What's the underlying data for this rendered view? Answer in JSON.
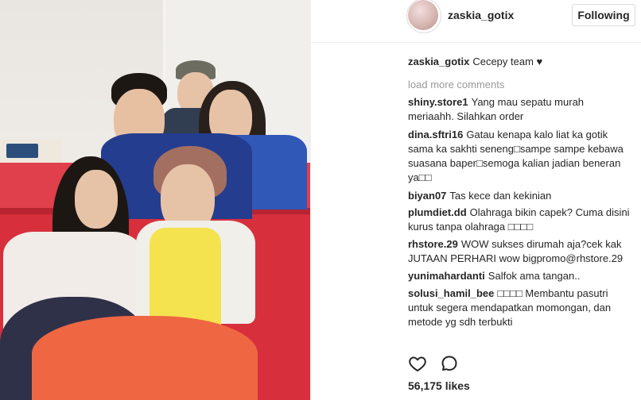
{
  "post": {
    "username": "zaskia_gotix",
    "follow_label": "Following",
    "caption_user": "zaskia_gotix",
    "caption_text": "Cecepy team ♥",
    "load_more": "load more comments",
    "likes": "56,175 likes"
  },
  "comments": [
    {
      "user": "shiny.store1",
      "text": "Yang mau sepatu murah meriaahh. Silahkan order"
    },
    {
      "user": "dina.sftri16",
      "text": "Gatau kenapa kalo liat ka gotik sama ka sakhti seneng□sampe sampe kebawa suasana baper□semoga kalian jadian beneran ya□□"
    },
    {
      "user": "biyan07",
      "text": "Tas kece dan kekinian"
    },
    {
      "user": "plumdiet.dd",
      "text": "Olahraga bikin capek? Cuma disini kurus tanpa olahraga □□□□"
    },
    {
      "user": "rhstore.29",
      "text": "WOW sukses dirumah aja?cek kak JUTAAN PERHARI wow bigpromo@rhstore.29"
    },
    {
      "user": "yunimahardanti",
      "text": "Salfok ama tangan.."
    },
    {
      "user": "solusi_hamil_bee",
      "text": "□□□□ Membantu pasutri untuk segera mendapatkan momongan, dan metode yg sdh terbukti"
    }
  ],
  "icons": {
    "like": "heart-outline-icon",
    "comment": "comment-bubble-icon"
  }
}
